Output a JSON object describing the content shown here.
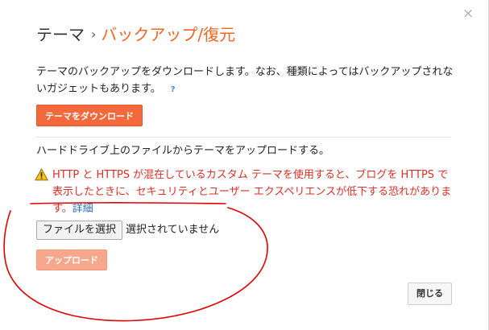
{
  "dialog": {
    "close_glyph": "×",
    "breadcrumb": {
      "root": "テーマ",
      "separator": "›",
      "current": "バックアップ/復元"
    },
    "backup_description": "テーマのバックアップをダウンロードします。なお、種類によってはバックアップされないガジェットもあります。",
    "help_glyph": "?",
    "download_button": "テーマをダウンロード",
    "upload_description": "ハードドライブ上のファイルからテーマをアップロードする。",
    "warning": {
      "text": "HTTP と HTTPS が混在しているカスタム テーマを使用すると、ブログを HTTPS で表示したときに、セキュリティとユーザー エクスペリエンスが低下する恐れがあります。",
      "link": "詳細",
      "icon": "warning-triangle-icon"
    },
    "file_input": {
      "button": "ファイルを選択",
      "status": "選択されていません"
    },
    "upload_button": "アップロード",
    "close_button": "閉じる"
  },
  "colors": {
    "accent": "#f26522",
    "primary_button": "#f4693b",
    "disabled_button": "#f7a88c",
    "warning_text": "#d93025",
    "link": "#2a6db5",
    "annotation_stroke": "#e00000"
  }
}
